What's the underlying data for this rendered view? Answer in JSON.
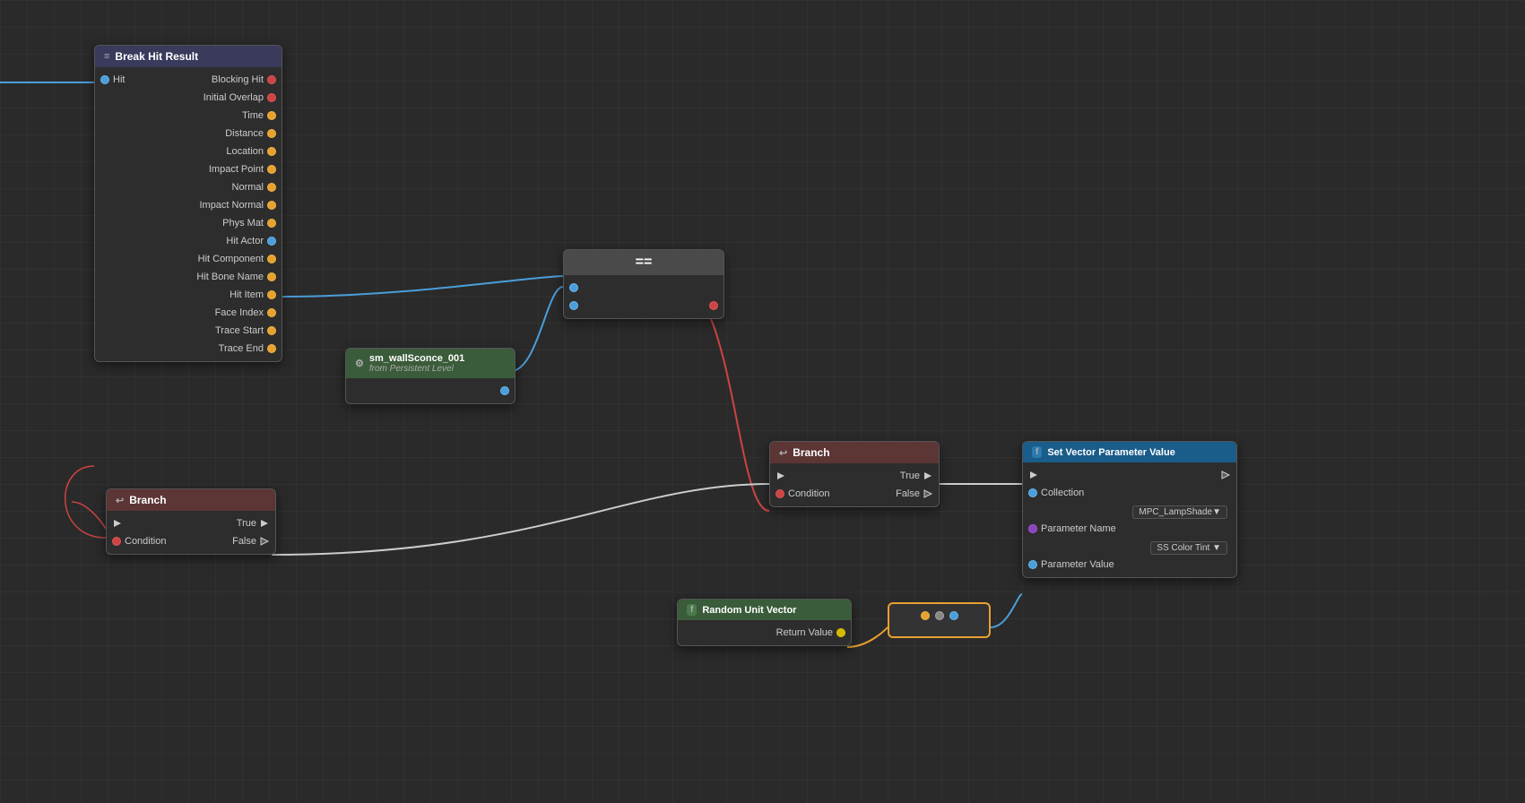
{
  "nodes": {
    "break_hit_result": {
      "title": "Break Hit Result",
      "title_icon": "≡",
      "pins_left": [
        {
          "label": "Hit",
          "pin_type": "blue",
          "side": "left"
        }
      ],
      "pins": [
        {
          "label": "Blocking Hit",
          "pin_type": "red",
          "side": "right"
        },
        {
          "label": "Initial Overlap",
          "pin_type": "red",
          "side": "right"
        },
        {
          "label": "Time",
          "pin_type": "orange",
          "side": "right"
        },
        {
          "label": "Distance",
          "pin_type": "orange",
          "side": "right"
        },
        {
          "label": "Location",
          "pin_type": "orange",
          "side": "right"
        },
        {
          "label": "Impact Point",
          "pin_type": "orange",
          "side": "right"
        },
        {
          "label": "Normal",
          "pin_type": "orange",
          "side": "right"
        },
        {
          "label": "Impact Normal",
          "pin_type": "orange",
          "side": "right"
        },
        {
          "label": "Phys Mat",
          "pin_type": "orange",
          "side": "right"
        },
        {
          "label": "Hit Actor",
          "pin_type": "blue",
          "side": "right"
        },
        {
          "label": "Hit Component",
          "pin_type": "orange",
          "side": "right"
        },
        {
          "label": "Hit Bone Name",
          "pin_type": "orange",
          "side": "right"
        },
        {
          "label": "Hit Item",
          "pin_type": "orange",
          "side": "right"
        },
        {
          "label": "Face Index",
          "pin_type": "orange",
          "side": "right"
        },
        {
          "label": "Trace Start",
          "pin_type": "orange",
          "side": "right"
        },
        {
          "label": "Trace End",
          "pin_type": "orange",
          "side": "right"
        }
      ]
    },
    "sconce": {
      "title": "sm_wallSconce_001",
      "subtitle": "from Persistent Level",
      "pin_type": "blue"
    },
    "equals": {
      "title": "==",
      "left_pins": [
        "blue",
        "blue"
      ],
      "right_pin": "red"
    },
    "branch_left": {
      "title": "Branch",
      "title_icon": "↩",
      "exec_in": true,
      "condition_label": "Condition",
      "true_label": "True",
      "false_label": "False"
    },
    "branch_center": {
      "title": "Branch",
      "title_icon": "↩",
      "exec_in": true,
      "condition_label": "Condition",
      "true_label": "True",
      "false_label": "False"
    },
    "set_vector": {
      "title": "Set Vector Parameter Value",
      "title_icon": "f",
      "collection_label": "Collection",
      "collection_value": "MPC_LampShade▼",
      "param_name_label": "Parameter Name",
      "param_name_value": "SS Color Tint ▼",
      "param_value_label": "Parameter Value"
    },
    "random_vector": {
      "title": "Random Unit Vector",
      "return_value_label": "Return Value"
    }
  },
  "labels": {
    "break_hit_result_title": "Break Hit Result",
    "hit": "Hit",
    "blocking_hit": "Blocking Hit",
    "initial_overlap": "Initial Overlap",
    "time": "Time",
    "distance": "Distance",
    "location": "Location",
    "impact_point": "Impact Point",
    "normal": "Normal",
    "impact_normal": "Impact Normal",
    "phys_mat": "Phys Mat",
    "hit_actor": "Hit Actor",
    "hit_component": "Hit Component",
    "hit_bone_name": "Hit Bone Name",
    "hit_item": "Hit Item",
    "face_index": "Face Index",
    "trace_start": "Trace Start",
    "trace_end": "Trace End",
    "sconce_title": "sm_wallSconce_001",
    "sconce_subtitle": "from Persistent Level",
    "branch_title": "Branch",
    "condition": "Condition",
    "true": "True",
    "false": "False",
    "set_vector_title": "Set Vector Parameter Value",
    "collection": "Collection",
    "mpc_lampshade": "MPC_LampShade▼",
    "parameter_name": "Parameter Name",
    "ss_color_tint": "SS Color Tint ▼",
    "parameter_value": "Parameter Value",
    "random_vector_title": "Random Unit Vector",
    "return_value": "Return Value"
  }
}
